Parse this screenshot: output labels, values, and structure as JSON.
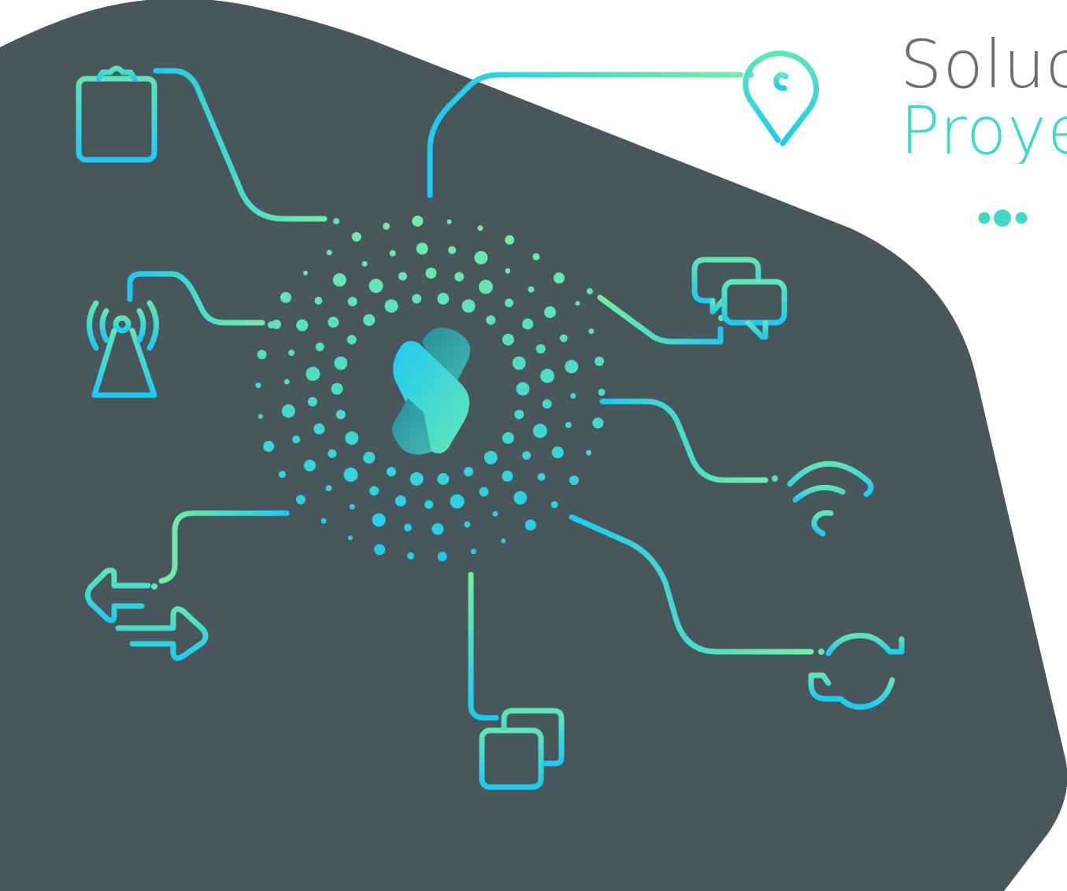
{
  "heading": {
    "line1": "Soluc",
    "line2": "Proye"
  },
  "colors": {
    "blob": "#47575b",
    "gradient_start": "#1ec9f2",
    "gradient_end": "#74eea3",
    "heading_gray": "#6d6e71",
    "heading_teal": "#3ed9c9"
  },
  "hub": {
    "logo": "s-logo"
  },
  "icons": [
    "clipboard-icon",
    "location-pin-icon",
    "chat-bubbles-icon",
    "wifi-icon",
    "sync-icon",
    "server-stack-icon",
    "bidirectional-arrows-icon",
    "radio-tower-icon",
    "more-dots-icon"
  ]
}
